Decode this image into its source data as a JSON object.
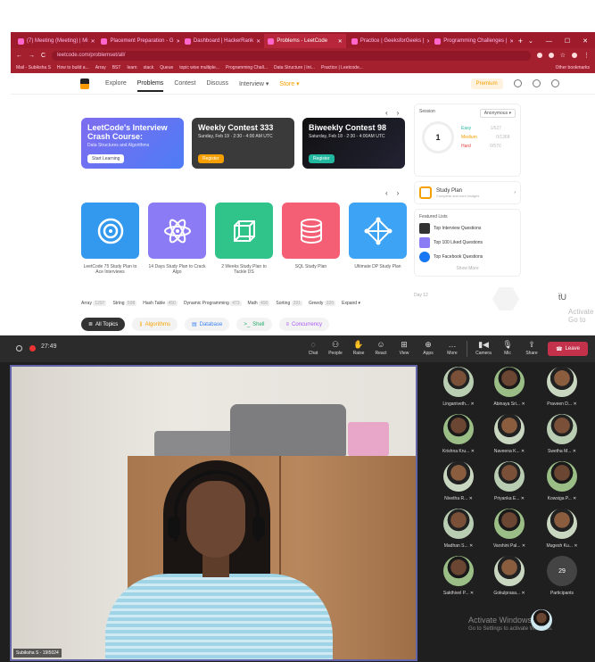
{
  "browser": {
    "tabs": [
      {
        "label": "(7) Meeting (Meeting) | Mi",
        "active": false
      },
      {
        "label": "Placement Preparation - G",
        "active": false
      },
      {
        "label": "Dashboard | HackerRank",
        "active": false
      },
      {
        "label": "Problems - LeetCode",
        "active": true
      },
      {
        "label": "Practice | GeeksforGeeks |",
        "active": false
      },
      {
        "label": "Programming Challenges |",
        "active": false
      }
    ],
    "new_tab": "+",
    "url": "leetcode.com/problemset/all/",
    "bookmarks": [
      "Mail - Subiksha S",
      "How to build a...",
      "Array",
      "BST",
      "learn",
      "stack",
      "Queue",
      "topic wise multiple...",
      "Programming Chall...",
      "Data Structure | Int...",
      "Practice | Leetcode..."
    ],
    "bookmarks_right": "Other bookmarks"
  },
  "leetcode": {
    "nav": [
      "Explore",
      "Problems",
      "Contest",
      "Discuss",
      "Interview ▾",
      "Store ▾"
    ],
    "premium": "Premium",
    "cards": [
      {
        "title": "LeetCode's Interview Crash Course:",
        "sub": "Data Structures and Algorithms",
        "button": "Start Learning"
      },
      {
        "title": "Weekly Contest 333",
        "sub": "Sunday, Feb 19 · 2:30 - 4:00 AM UTC",
        "button": "Register"
      },
      {
        "title": "Biweekly Contest 98",
        "sub": "Saturday, Feb 18 · 2:30 - 4:00AM UTC",
        "button": "Register"
      }
    ],
    "study_plans": [
      "LeetCode 75 Study Plan to Ace Interviews",
      "14 Days Study Plan to Crack Algo",
      "2 Weeks Study Plan to Tackle DS",
      "SQL Study Plan",
      "Ultimate DP Study Plan"
    ],
    "tags": [
      {
        "name": "Array",
        "count": "1297"
      },
      {
        "name": "String",
        "count": "598"
      },
      {
        "name": "Hash Table",
        "count": "450"
      },
      {
        "name": "Dynamic Programming",
        "count": "473"
      },
      {
        "name": "Math",
        "count": "490"
      },
      {
        "name": "Sorting",
        "count": "291"
      },
      {
        "name": "Greedy",
        "count": "320"
      },
      {
        "name": "Expand ▾",
        "count": ""
      }
    ],
    "topics": [
      {
        "label": "All Topics",
        "icon": "≣"
      },
      {
        "label": "Algorithms",
        "icon": "⟫"
      },
      {
        "label": "Database",
        "icon": "▤"
      },
      {
        "label": "Shell",
        "icon": ">_"
      },
      {
        "label": "Concurrency",
        "icon": "≡"
      }
    ],
    "session": {
      "label": "Session",
      "select": "Anonymous ▾",
      "solved": "1",
      "solved_label": "Solved",
      "easy": "Easy",
      "easy_n": "1/627",
      "medium": "Medium",
      "medium_n": "0/1368",
      "hard": "Hard",
      "hard_n": "0/570"
    },
    "study_plan": {
      "title": "Study Plan",
      "sub": "Complete and earn badges"
    },
    "featured": {
      "title": "Featured Lists",
      "items": [
        "Top Interview Questions",
        "Top 100 Liked Questions",
        "Top Facebook Questions"
      ],
      "show_more": "Show More"
    },
    "day": "Day 12",
    "windows_watermark": "Activate Go to"
  },
  "meeting": {
    "timer": "27:49",
    "controls": [
      {
        "label": "Chat",
        "icon": "chat-icon",
        "glyph": "◌"
      },
      {
        "label": "People",
        "icon": "people-icon",
        "glyph": "⚇"
      },
      {
        "label": "Raise",
        "icon": "hand-icon",
        "glyph": "✋"
      },
      {
        "label": "React",
        "icon": "smile-icon",
        "glyph": "☺"
      },
      {
        "label": "View",
        "icon": "grid-icon",
        "glyph": "⊞"
      },
      {
        "label": "Apps",
        "icon": "apps-icon",
        "glyph": "⊕"
      },
      {
        "label": "More",
        "icon": "more-icon",
        "glyph": "…"
      },
      {
        "label": "Camera",
        "icon": "camera-icon",
        "glyph": "▮◀"
      },
      {
        "label": "Mic",
        "icon": "mic-off-icon",
        "glyph": "🎙"
      },
      {
        "label": "Share",
        "icon": "share-icon",
        "glyph": "⇪"
      }
    ],
    "leave": "Leave",
    "presenter": "Subiksha S - 19I5024",
    "participants": [
      "Linganiveth...",
      "Abinaya Sri...",
      "Praveen D...",
      "Krishna Kru...",
      "Naveena K...",
      "Swetha M...",
      "Nivetha R...",
      "Priyanka E...",
      "Kowsiga P...",
      "Madhan S...",
      "Varshini Pal...",
      "Mugesh Ku...",
      "Sakthivel P...",
      "Gokulprasa..."
    ],
    "more_count": "29",
    "more_label": "Participants",
    "activate_title": "Activate Windows",
    "activate_sub": "Go to Settings to activate Windows."
  }
}
